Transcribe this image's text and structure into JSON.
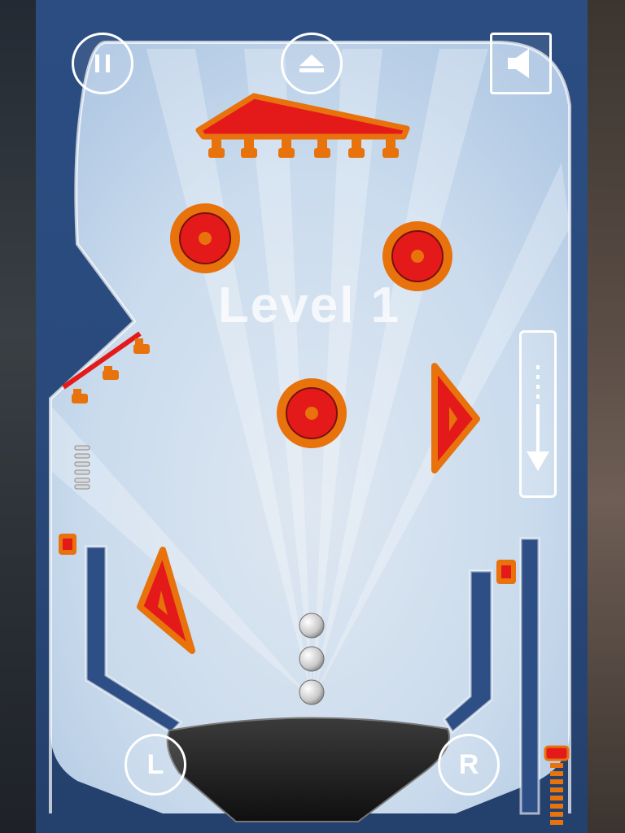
{
  "hud": {
    "pause_icon": "pause-icon",
    "eject_icon": "eject-icon",
    "sound_icon": "speaker-icon"
  },
  "level": {
    "label": "Level 1"
  },
  "controls": {
    "left_flipper_label": "L",
    "right_flipper_label": "R"
  },
  "launch": {
    "icon": "down-arrow-icon"
  },
  "balls_remaining": 3,
  "colors": {
    "bumper_red": "#e41a1a",
    "bumper_orange": "#e8720c",
    "table_glass": "#d4e6f8",
    "rail_blue": "#2d4f86"
  }
}
